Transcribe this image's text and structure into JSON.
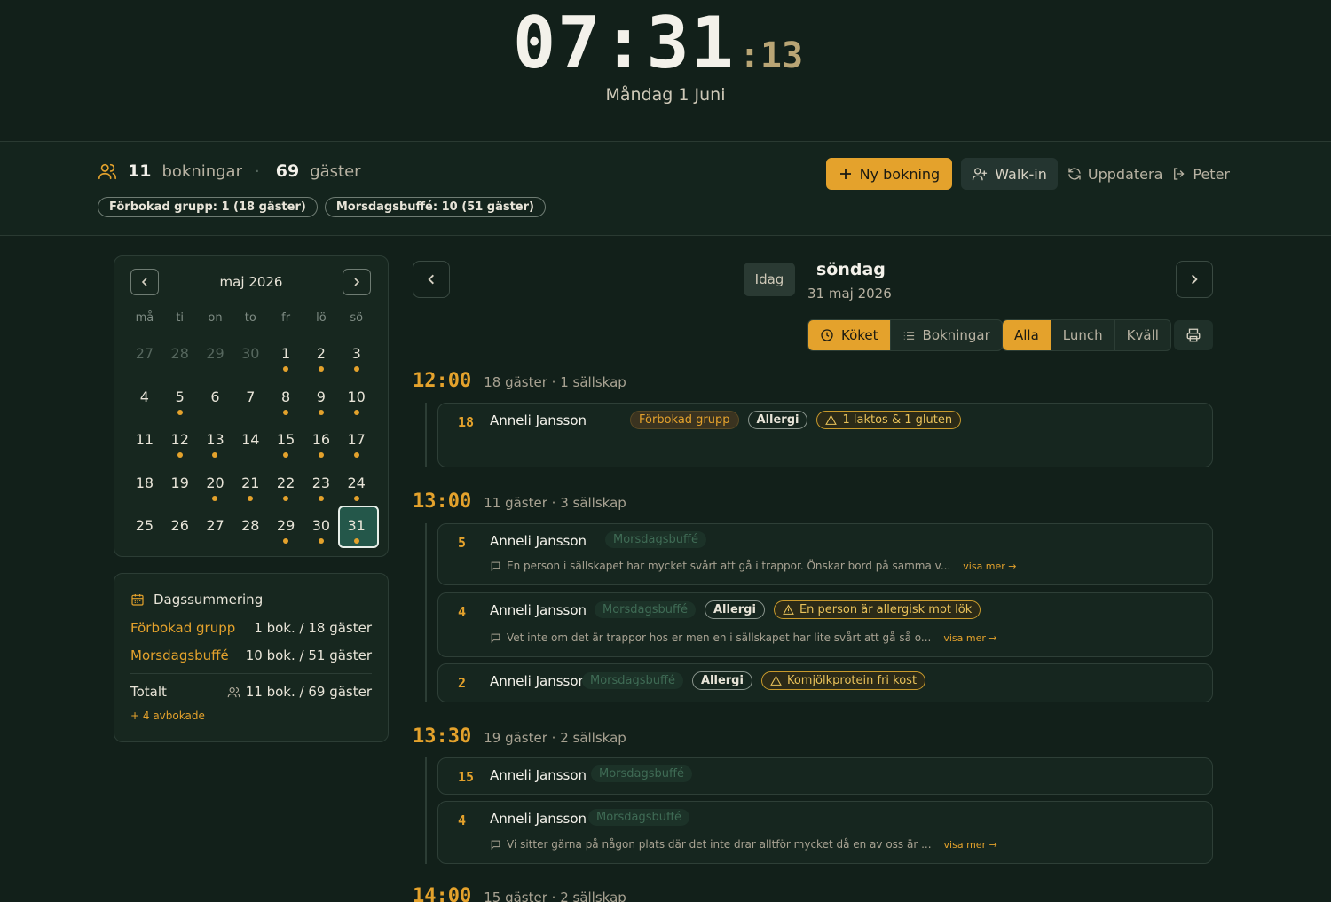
{
  "clock": {
    "hm": "07:31",
    "sec": ":13",
    "date": "Måndag 1 Juni"
  },
  "stats": {
    "bookings_num": "11",
    "bookings_label": "bokningar",
    "guests_num": "69",
    "guests_label": "gäster",
    "sep": "·"
  },
  "chips": [
    "Förbokad grupp: 1 (18 gäster)",
    "Morsdagsbuffé: 10 (51 gäster)"
  ],
  "actions": {
    "new_booking": "Ny bokning",
    "walk_in": "Walk-in",
    "refresh": "Uppdatera",
    "user": "Peter"
  },
  "calendar": {
    "title": "maj 2026",
    "weekdays": [
      "må",
      "ti",
      "on",
      "to",
      "fr",
      "lö",
      "sö"
    ],
    "days": [
      {
        "d": "27",
        "muted": true
      },
      {
        "d": "28",
        "muted": true
      },
      {
        "d": "29",
        "muted": true
      },
      {
        "d": "30",
        "muted": true
      },
      {
        "d": "1",
        "mark": true
      },
      {
        "d": "2",
        "mark": true
      },
      {
        "d": "3",
        "mark": true
      },
      {
        "d": "4"
      },
      {
        "d": "5",
        "mark": true
      },
      {
        "d": "6"
      },
      {
        "d": "7"
      },
      {
        "d": "8",
        "mark": true
      },
      {
        "d": "9",
        "mark": true
      },
      {
        "d": "10",
        "mark": true
      },
      {
        "d": "11"
      },
      {
        "d": "12",
        "mark": true
      },
      {
        "d": "13",
        "mark": true
      },
      {
        "d": "14"
      },
      {
        "d": "15",
        "mark": true
      },
      {
        "d": "16",
        "mark": true
      },
      {
        "d": "17",
        "mark": true
      },
      {
        "d": "18"
      },
      {
        "d": "19"
      },
      {
        "d": "20",
        "mark": true
      },
      {
        "d": "21",
        "mark": true
      },
      {
        "d": "22",
        "mark": true
      },
      {
        "d": "23",
        "mark": true
      },
      {
        "d": "24",
        "mark": true
      },
      {
        "d": "25"
      },
      {
        "d": "26"
      },
      {
        "d": "27"
      },
      {
        "d": "28"
      },
      {
        "d": "29",
        "mark": true
      },
      {
        "d": "30",
        "mark": true
      },
      {
        "d": "31",
        "mark": true,
        "selected": true
      }
    ]
  },
  "day_summary": {
    "title": "Dagssummering",
    "rows": [
      {
        "label": "Förbokad grupp",
        "value": "1 bok. / 18 gäster"
      },
      {
        "label": "Morsdagsbuffé",
        "value": "10 bok. / 51 gäster"
      }
    ],
    "total_label": "Totalt",
    "total_value": "11 bok. / 69 gäster",
    "cancelled": "+ 4 avbokade"
  },
  "day_view": {
    "today": "Idag",
    "day_name": "söndag",
    "date": "31 maj 2026",
    "views": [
      "Köket",
      "Bokningar"
    ],
    "filters": [
      "Alla",
      "Lunch",
      "Kväll"
    ]
  },
  "slots": [
    {
      "time": "12:00",
      "info": "18 gäster · 1 sällskap",
      "bookings": [
        {
          "guests": "18",
          "name": "Anneli Jansson",
          "tags": [
            {
              "kind": "grp",
              "text": "Förbokad grupp"
            },
            {
              "kind": "al",
              "text": "Allergi"
            },
            {
              "kind": "warn",
              "text": "1 laktos & 1 gluten"
            }
          ],
          "note": ""
        }
      ]
    },
    {
      "time": "13:00",
      "info": "11 gäster · 3 sällskap",
      "bookings": [
        {
          "guests": "5",
          "name": "Anneli Jansson",
          "tags": [
            {
              "kind": "buf",
              "text": "Morsdagsbuffé"
            }
          ],
          "note": "En person i sällskapet har mycket svårt att gå i trappor. Önskar bord på samma v..."
        },
        {
          "guests": "4",
          "name": "Anneli Jansson",
          "tags": [
            {
              "kind": "buf",
              "text": "Morsdagsbuffé"
            },
            {
              "kind": "al",
              "text": "Allergi"
            },
            {
              "kind": "warn",
              "text": "En person är allergisk mot lök"
            }
          ],
          "note": "Vet inte om det är trappor hos er men en i sällskapet har lite svårt att gå så o..."
        },
        {
          "guests": "2",
          "name": "Anneli Jansson",
          "tags": [
            {
              "kind": "buf",
              "text": "Morsdagsbuffé"
            },
            {
              "kind": "al",
              "text": "Allergi"
            },
            {
              "kind": "warn",
              "text": "Komjölkprotein fri kost"
            }
          ],
          "note": ""
        }
      ]
    },
    {
      "time": "13:30",
      "info": "19 gäster · 2 sällskap",
      "bookings": [
        {
          "guests": "15",
          "name": "Anneli Jansson",
          "tags": [
            {
              "kind": "buf",
              "text": "Morsdagsbuffé"
            }
          ],
          "note": ""
        },
        {
          "guests": "4",
          "name": "Anneli Jansson",
          "tags": [
            {
              "kind": "buf",
              "text": "Morsdagsbuffé"
            }
          ],
          "note": "Vi sitter gärna på någon plats där det inte drar alltför mycket då en av oss är ..."
        }
      ]
    },
    {
      "time": "14:00",
      "info": "15 gäster · 2 sällskap",
      "bookings": []
    }
  ],
  "note_more": "visa mer →",
  "colors": {
    "accent": "#e4a22c",
    "background": "#12201a"
  }
}
